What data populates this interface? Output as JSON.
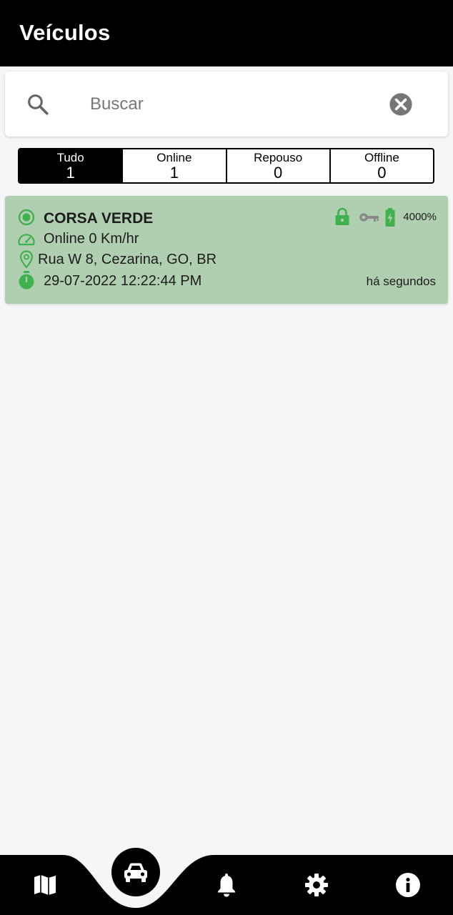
{
  "appbar": {
    "title": "Veículos"
  },
  "search": {
    "placeholder": "Buscar",
    "value": ""
  },
  "filters": [
    {
      "label": "Tudo",
      "count": "1",
      "active": true
    },
    {
      "label": "Online",
      "count": "1",
      "active": false
    },
    {
      "label": "Repouso",
      "count": "0",
      "active": false
    },
    {
      "label": "Offline",
      "count": "0",
      "active": false
    }
  ],
  "vehicles": [
    {
      "name": "CORSA VERDE",
      "status": "Online 0 Km/hr",
      "address": "Rua W 8, Cezarina, GO, BR",
      "datetime": "29-07-2022 12:22:44 PM",
      "ago": "há segundos",
      "battery": "4000%"
    }
  ],
  "bottom_nav": {
    "items": [
      "map-icon",
      "car-icon",
      "bell-icon",
      "gear-icon",
      "info-icon"
    ],
    "active": "car-icon"
  },
  "colors": {
    "accent": "#000000",
    "card": "#b0cfb1",
    "status_green": "#3fb14f",
    "inactive_icon": "#8a8a8a"
  }
}
